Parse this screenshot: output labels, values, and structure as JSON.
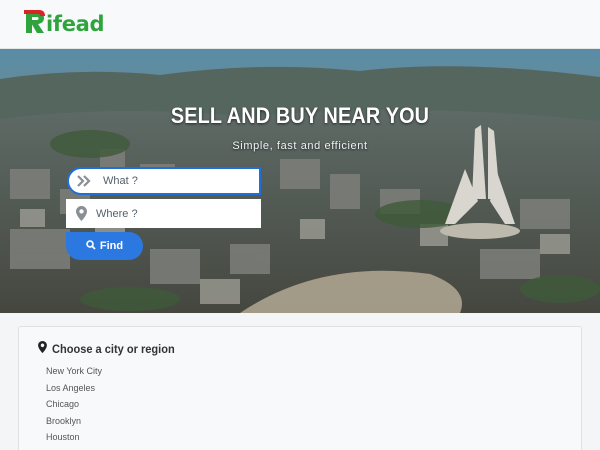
{
  "header": {
    "logo_text": "ifead",
    "logo_letter": "R",
    "colors": {
      "brand_green": "#2fa43e",
      "brand_red": "#d92525"
    }
  },
  "hero": {
    "title": "SELL AND BUY NEAR YOU",
    "subtitle": "Simple, fast and efficient",
    "what_placeholder": "What ?",
    "where_placeholder": "Where ?",
    "find_label": "Find",
    "icons": {
      "what": "double-chevron-right-icon",
      "where": "map-pin-icon",
      "find": "search-icon"
    },
    "colors": {
      "accent": "#2b78e0"
    }
  },
  "regions": {
    "title": "Choose a city or region",
    "title_icon": "map-marker-icon",
    "cities": [
      "New York City",
      "Los Angeles",
      "Chicago",
      "Brooklyn",
      "Houston"
    ]
  }
}
